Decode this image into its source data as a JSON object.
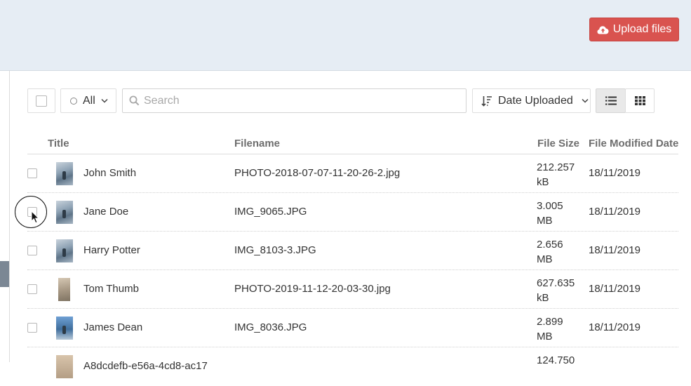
{
  "header": {
    "upload_label": "Upload files",
    "upload_icon": "cloud-upload-icon",
    "background": "#e6edf4",
    "upload_color": "#d9534f"
  },
  "toolbar": {
    "filter_value": "All",
    "search_placeholder": "Search",
    "search_value": "",
    "sort_value": "Date Uploaded",
    "view_mode": "list"
  },
  "table": {
    "columns": [
      "Title",
      "Filename",
      "File Size",
      "File Modified Date"
    ],
    "rows": [
      {
        "title": "John Smith",
        "filename": "PHOTO-2018-07-07-11-20-26-2.jpg",
        "size_value": "212.257",
        "size_unit": "kB",
        "date": "18/11/2019"
      },
      {
        "title": "Jane Doe",
        "filename": "IMG_9065.JPG",
        "size_value": "3.005",
        "size_unit": "MB",
        "date": "18/11/2019"
      },
      {
        "title": "Harry Potter",
        "filename": "IMG_8103-3.JPG",
        "size_value": "2.656",
        "size_unit": "MB",
        "date": "18/11/2019"
      },
      {
        "title": "Tom Thumb",
        "filename": "PHOTO-2019-11-12-20-03-30.jpg",
        "size_value": "627.635",
        "size_unit": "kB",
        "date": "18/11/2019"
      },
      {
        "title": "James Dean",
        "filename": "IMG_8036.JPG",
        "size_value": "2.899",
        "size_unit": "MB",
        "date": "18/11/2019"
      },
      {
        "title": "A8dcdefb-e56a-4cd8-ac17",
        "filename": "",
        "size_value": "124.750",
        "size_unit": "",
        "date": ""
      }
    ]
  }
}
